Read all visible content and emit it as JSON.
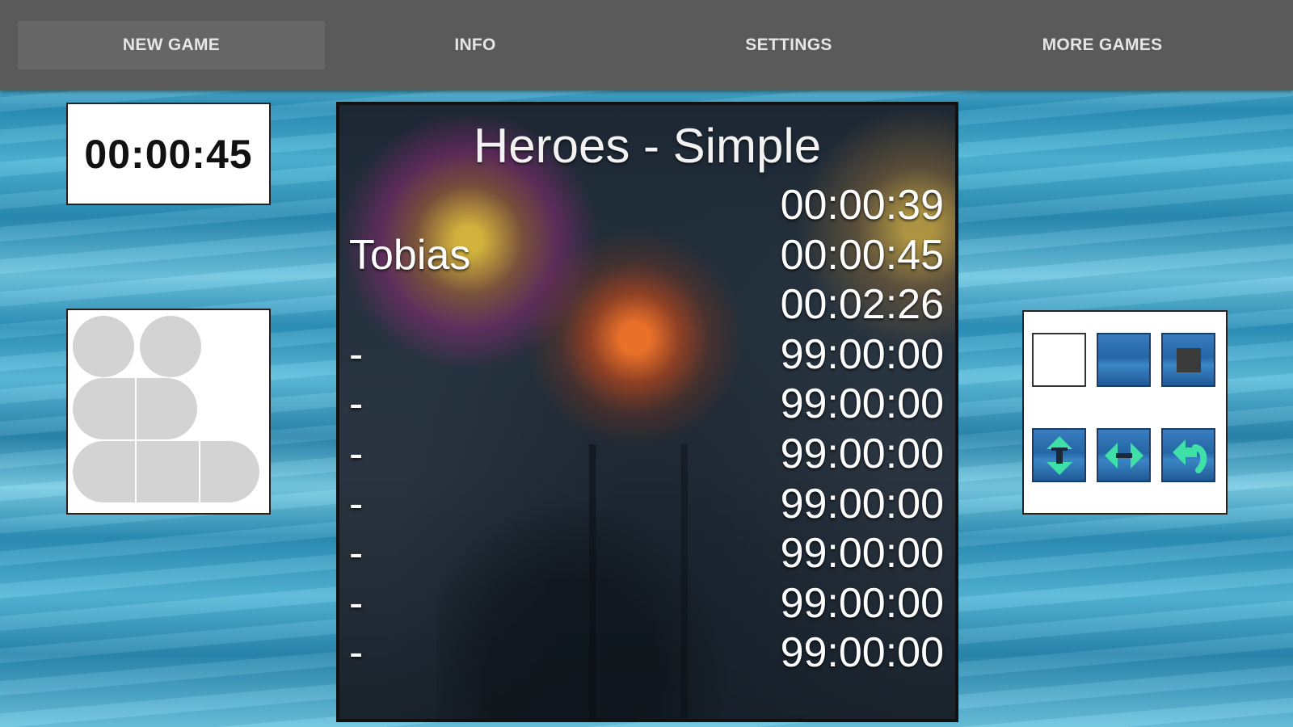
{
  "menu": {
    "tabs": [
      {
        "label": "NEW GAME",
        "active": true
      },
      {
        "label": "INFO",
        "active": false
      },
      {
        "label": "SETTINGS",
        "active": false
      },
      {
        "label": "MORE GAMES",
        "active": false
      }
    ]
  },
  "timer": {
    "value": "00:00:45"
  },
  "highscores": {
    "title": "Heroes - Simple",
    "rows": [
      {
        "name": "",
        "time": "00:00:39"
      },
      {
        "name": "Tobias",
        "time": "00:00:45"
      },
      {
        "name": "",
        "time": "00:02:26"
      },
      {
        "name": "-",
        "time": "99:00:00"
      },
      {
        "name": "-",
        "time": "99:00:00"
      },
      {
        "name": "-",
        "time": "99:00:00"
      },
      {
        "name": "-",
        "time": "99:00:00"
      },
      {
        "name": "-",
        "time": "99:00:00"
      },
      {
        "name": "-",
        "time": "99:00:00"
      },
      {
        "name": "-",
        "time": "99:00:00"
      }
    ]
  },
  "piece_preview": {
    "color": "#d3d3d3"
  },
  "tools": [
    {
      "icon": "blank-tile-icon"
    },
    {
      "icon": "water-tile-icon"
    },
    {
      "icon": "stop-square-icon"
    },
    {
      "icon": "flip-vertical-icon"
    },
    {
      "icon": "flip-horizontal-icon"
    },
    {
      "icon": "undo-arrow-icon"
    }
  ],
  "colors": {
    "accent_arrow": "#3fe0a8",
    "menu_bg": "#5a5a5a"
  }
}
